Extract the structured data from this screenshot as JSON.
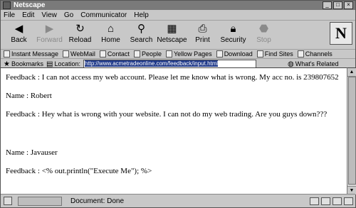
{
  "window": {
    "title": "Netscape"
  },
  "menu": [
    "File",
    "Edit",
    "View",
    "Go",
    "Communicator",
    "Help"
  ],
  "toolbar": {
    "back": "Back",
    "forward": "Forward",
    "reload": "Reload",
    "home": "Home",
    "search": "Search",
    "netscape": "Netscape",
    "print": "Print",
    "security": "Security",
    "stop": "Stop",
    "logo": "N"
  },
  "personal_bar": [
    "Instant Message",
    "WebMail",
    "Contact",
    "People",
    "Yellow Pages",
    "Download",
    "Find Sites",
    "Channels"
  ],
  "location": {
    "bookmarks_label": "Bookmarks",
    "location_label": "Location:",
    "url": "http://www.acmetradeonline.com/feedback/input.html",
    "related_label": "What's Related"
  },
  "content": {
    "lines": [
      "Feedback : I can not access my web account. Please let me know what is wrong. My acc no. is 239807652",
      "Name : Robert",
      "Feedback : Hey what is wrong with your website. I can not do my web trading. Are you guys down???",
      "Name : Javauser",
      "Feedback : <% out.println(\"Execute Me\"); %>"
    ]
  },
  "status": {
    "text": "Document: Done"
  }
}
